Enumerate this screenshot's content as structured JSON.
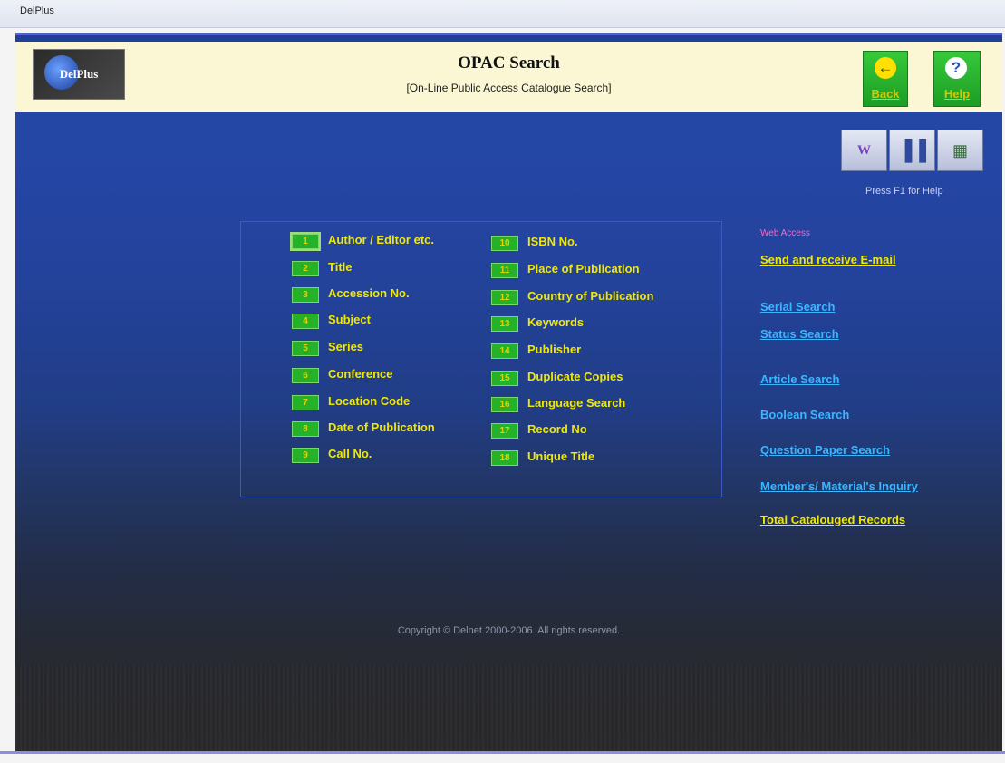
{
  "window": {
    "title": "DelPlus"
  },
  "header": {
    "logo_text": "DelPlus",
    "title": "OPAC Search",
    "subtitle": "[On-Line Public Access Catalogue Search]",
    "back_label": "Back",
    "help_label": "Help"
  },
  "toolbar": {
    "hint": "Press F1 for Help"
  },
  "search_options": {
    "left": [
      {
        "num": "1",
        "label": "Author / Editor etc."
      },
      {
        "num": "2",
        "label": "Title"
      },
      {
        "num": "3",
        "label": "Accession No."
      },
      {
        "num": "4",
        "label": "Subject"
      },
      {
        "num": "5",
        "label": "Series"
      },
      {
        "num": "6",
        "label": "Conference"
      },
      {
        "num": "7",
        "label": "Location Code"
      },
      {
        "num": "8",
        "label": "Date of Publication"
      },
      {
        "num": "9",
        "label": "Call No."
      }
    ],
    "right": [
      {
        "num": "10",
        "label": "ISBN No."
      },
      {
        "num": "11",
        "label": "Place of Publication"
      },
      {
        "num": "12",
        "label": "Country of Publication"
      },
      {
        "num": "13",
        "label": "Keywords"
      },
      {
        "num": "14",
        "label": "Publisher"
      },
      {
        "num": "15",
        "label": "Duplicate Copies"
      },
      {
        "num": "16",
        "label": "Language Search"
      },
      {
        "num": "17",
        "label": "Record No"
      },
      {
        "num": "18",
        "label": "Unique Title"
      }
    ]
  },
  "side_links": {
    "web_access": "Web Access",
    "email": "Send and receive E-mail",
    "serial": "Serial Search",
    "status": "Status Search",
    "article": "Article Search",
    "boolean": "Boolean Search",
    "question_paper": "Question Paper Search",
    "inquiry": "Member's/ Material's Inquiry",
    "total_records": "Total Catalouged Records"
  },
  "footer": {
    "copyright": "Copyright © Delnet 2000-2006. All rights reserved."
  }
}
